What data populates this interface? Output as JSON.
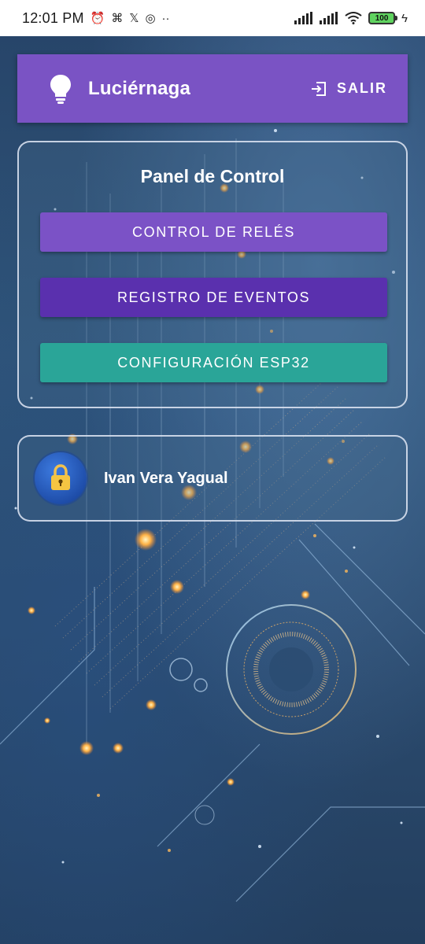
{
  "status_bar": {
    "time": "12:01 PM",
    "left_icons": [
      "alarm-icon",
      "capcut-icon",
      "x-icon",
      "instagram-icon",
      "more-dots-icon"
    ],
    "right_icons": [
      "signal-icon",
      "signal-icon",
      "wifi-icon",
      "battery-icon",
      "charging-icon"
    ],
    "battery_level": "100"
  },
  "app_bar": {
    "icon": "lightbulb-icon",
    "title": "Luciérnaga",
    "logout_icon": "logout-icon",
    "logout_label": "SALIR",
    "color": "#7a53c4"
  },
  "panel": {
    "title": "Panel de Control",
    "buttons": [
      {
        "label": "CONTROL DE RELÉS",
        "color": "#7b52c6"
      },
      {
        "label": "REGISTRO DE EVENTOS",
        "color": "#5a30ae"
      },
      {
        "label": "CONFIGURACIÓN ESP32",
        "color": "#2aa598"
      }
    ]
  },
  "user_card": {
    "avatar_icon": "lock-icon",
    "name": "Ivan Vera Yagual"
  }
}
